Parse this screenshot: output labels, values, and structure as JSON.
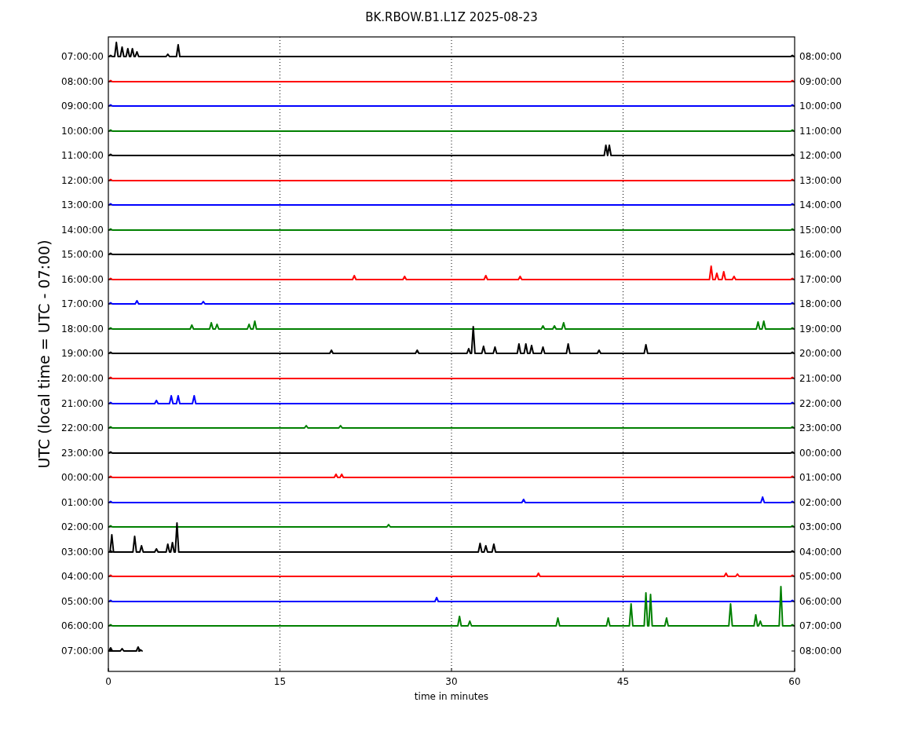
{
  "title": "BK.RBOW.B1.L1Z 2025-08-23",
  "ylabel": "UTC (local time = UTC - 07:00)",
  "xlabel": "time in minutes",
  "xticks": [
    "0",
    "15",
    "30",
    "45",
    "60"
  ],
  "rows": [
    {
      "left": "07:00:00",
      "right": "08:00:00",
      "color": "#000000",
      "level": 1
    },
    {
      "left": "08:00:00",
      "right": "09:00:00",
      "color": "#ff0000",
      "level": 1
    },
    {
      "left": "09:00:00",
      "right": "10:00:00",
      "color": "#0000ff",
      "level": 1
    },
    {
      "left": "10:00:00",
      "right": "11:00:00",
      "color": "#008000",
      "level": 1
    },
    {
      "left": "11:00:00",
      "right": "12:00:00",
      "color": "#000000",
      "level": 1
    },
    {
      "left": "12:00:00",
      "right": "13:00:00",
      "color": "#ff0000",
      "level": 1
    },
    {
      "left": "13:00:00",
      "right": "14:00:00",
      "color": "#0000ff",
      "level": 1
    },
    {
      "left": "14:00:00",
      "right": "15:00:00",
      "color": "#008000",
      "level": 1
    },
    {
      "left": "15:00:00",
      "right": "16:00:00",
      "color": "#000000",
      "level": 1
    },
    {
      "left": "16:00:00",
      "right": "17:00:00",
      "color": "#ff0000",
      "level": 1
    },
    {
      "left": "17:00:00",
      "right": "18:00:00",
      "color": "#0000ff",
      "level": 1
    },
    {
      "left": "18:00:00",
      "right": "19:00:00",
      "color": "#008000",
      "level": 1
    },
    {
      "left": "19:00:00",
      "right": "20:00:00",
      "color": "#000000",
      "level": 1
    },
    {
      "left": "20:00:00",
      "right": "21:00:00",
      "color": "#ff0000",
      "level": 1
    },
    {
      "left": "21:00:00",
      "right": "22:00:00",
      "color": "#0000ff",
      "level": 1
    },
    {
      "left": "22:00:00",
      "right": "23:00:00",
      "color": "#008000",
      "level": 1
    },
    {
      "left": "23:00:00",
      "right": "00:00:00",
      "color": "#000000",
      "level": 1
    },
    {
      "left": "00:00:00",
      "right": "01:00:00",
      "color": "#ff0000",
      "level": 1
    },
    {
      "left": "01:00:00",
      "right": "02:00:00",
      "color": "#0000ff",
      "level": 1
    },
    {
      "left": "02:00:00",
      "right": "03:00:00",
      "color": "#008000",
      "level": 1
    },
    {
      "left": "03:00:00",
      "right": "04:00:00",
      "color": "#000000",
      "level": 1
    },
    {
      "left": "04:00:00",
      "right": "05:00:00",
      "color": "#ff0000",
      "level": 1
    },
    {
      "left": "05:00:00",
      "right": "06:00:00",
      "color": "#0000ff",
      "level": 1
    },
    {
      "left": "06:00:00",
      "right": "07:00:00",
      "color": "#008000",
      "level": 1
    },
    {
      "left": "07:00:00",
      "right": "08:00:00",
      "color": "#000000",
      "level": 0.05
    }
  ]
}
